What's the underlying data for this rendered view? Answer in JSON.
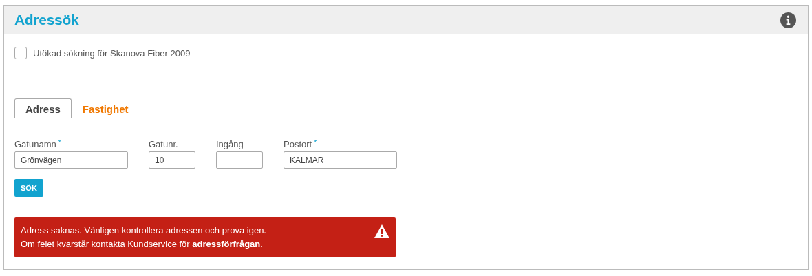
{
  "header": {
    "title": "Adressök"
  },
  "extended_search": {
    "label": "Utökad sökning för Skanova Fiber 2009",
    "checked": false
  },
  "tabs": [
    {
      "label": "Adress",
      "selected": true
    },
    {
      "label": "Fastighet",
      "selected": false
    }
  ],
  "fields": [
    {
      "label": "Gatunamn",
      "required_mark": "*",
      "value": "Grönvägen"
    },
    {
      "label": "Gatunr.",
      "value": "10"
    },
    {
      "label": "Ingång"
    },
    {
      "label": "Postort",
      "required_mark": "*",
      "value": "KALMAR"
    }
  ],
  "search_button": "SÖK",
  "error": {
    "lines": [
      "Adress saknas. Vänligen kontrollera adressen och prova igen.",
      "Om felet kvarstår kontakta Kundservice för **adressförfrågan**."
    ]
  }
}
